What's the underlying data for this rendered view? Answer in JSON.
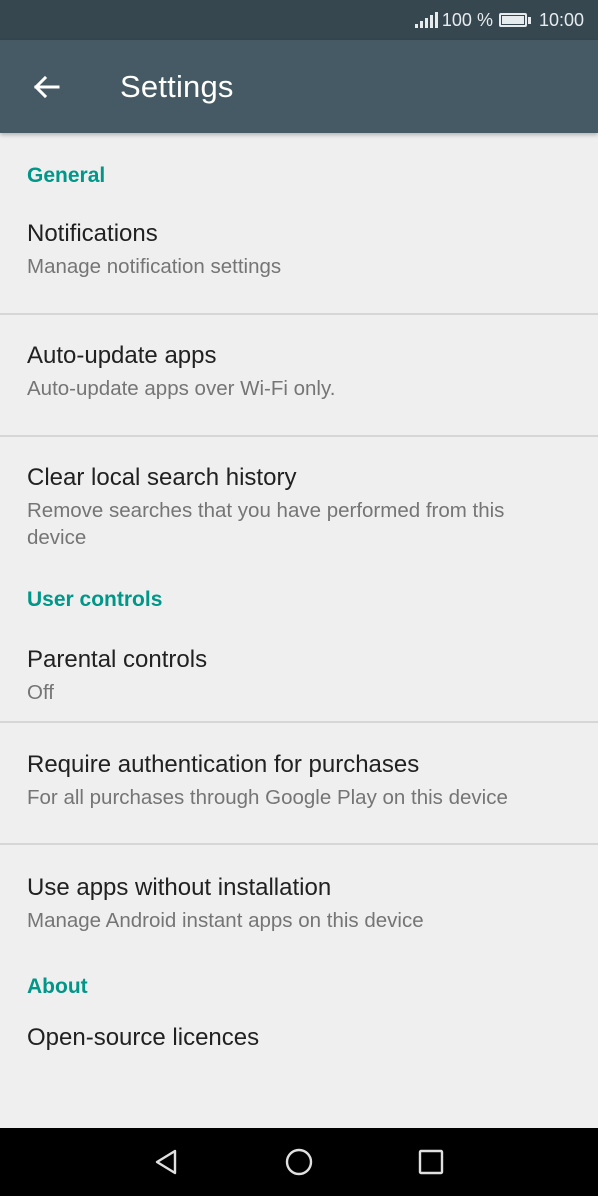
{
  "status_bar": {
    "battery_percent": "100 %",
    "time": "10:00",
    "signal_icon": "signal-icon",
    "battery_icon": "battery-icon"
  },
  "app_bar": {
    "back_icon": "arrow-back-icon",
    "title": "Settings"
  },
  "sections": {
    "general": {
      "header": "General",
      "items": [
        {
          "title": "Notifications",
          "subtitle": "Manage notification settings"
        },
        {
          "title": "Auto-update apps",
          "subtitle": "Auto-update apps over Wi-Fi only."
        },
        {
          "title": "Clear local search history",
          "subtitle_line1": "Remove searches that you have performed from this",
          "subtitle_line2": "device"
        }
      ]
    },
    "user_controls": {
      "header": "User controls",
      "items": [
        {
          "title": "Parental controls",
          "subtitle": "Off"
        },
        {
          "title": "Require authentication for purchases",
          "subtitle": "For all purchases through Google Play on this device"
        },
        {
          "title": "Use apps without installation",
          "subtitle": "Manage Android instant apps on this device"
        }
      ]
    },
    "about": {
      "header": "About",
      "items": [
        {
          "title": "Open-source licences"
        }
      ]
    }
  },
  "nav_bar": {
    "back_icon": "nav-back-icon",
    "home_icon": "nav-home-icon",
    "recents_icon": "nav-recents-icon"
  },
  "colors": {
    "status_bar": "#37474f",
    "app_bar": "#455a64",
    "accent": "#009688",
    "background": "#efefef"
  }
}
